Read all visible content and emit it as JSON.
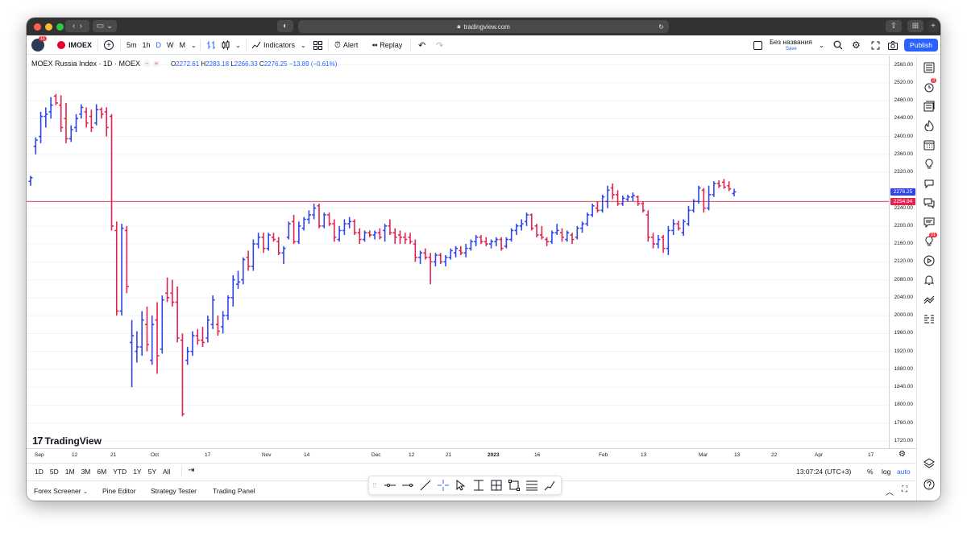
{
  "browser": {
    "url": "tradingview.com"
  },
  "toolbar": {
    "avatar_badge": "11",
    "symbol": "IMOEX",
    "intervals": [
      "5m",
      "1h",
      "D",
      "W",
      "M"
    ],
    "active_interval": "D",
    "indicators_label": "Indicators",
    "alert_label": "Alert",
    "replay_label": "Replay",
    "layout_name": "Без названия",
    "layout_status": "Save",
    "publish_label": "Publish"
  },
  "legend": {
    "title": "MOEX Russia Index · 1D · MOEX",
    "o_label": "O",
    "o_value": "2272.61",
    "h_label": "H",
    "h_value": "2283.18",
    "l_label": "L",
    "l_value": "2266.33",
    "c_label": "C",
    "c_value": "2276.25",
    "change": "−13.89 (−0.61%)"
  },
  "price_axis": {
    "labels": [
      "2560.00",
      "2520.00",
      "2480.00",
      "2440.00",
      "2400.00",
      "2360.00",
      "2320.00",
      "2240.00",
      "2200.00",
      "2160.00",
      "2120.00",
      "2080.00",
      "2040.00",
      "2000.00",
      "1960.00",
      "1920.00",
      "1880.00",
      "1840.00",
      "1800.00",
      "1760.00",
      "1720.00"
    ],
    "last_price": "2276.25",
    "reference_price": "2254.94"
  },
  "time_axis": {
    "labels": [
      "Sep",
      "12",
      "21",
      "Oct",
      "17",
      "Nov",
      "14",
      "Dec",
      "12",
      "21",
      "2023",
      "16",
      "Feb",
      "13",
      "Mar",
      "13",
      "22",
      "Apr",
      "17"
    ]
  },
  "watermark": "TradingView",
  "range_bar": {
    "ranges": [
      "1D",
      "5D",
      "1M",
      "3M",
      "6M",
      "YTD",
      "1Y",
      "5Y",
      "All"
    ],
    "clock": "13:07:24 (UTC+3)",
    "percent_label": "%",
    "log_label": "log",
    "auto_label": "auto"
  },
  "bottom_bar": {
    "tabs": [
      "Forex Screener",
      "Pine Editor",
      "Strategy Tester",
      "Trading Panel"
    ]
  },
  "right_bar": {
    "notification_badge": "3",
    "alerts_badge": "21"
  },
  "colors": {
    "up": "#2f45e8",
    "down": "#e3224f",
    "accent": "#2962ff",
    "reference_line": "#e3224f"
  },
  "chart_data": {
    "type": "ohlc",
    "symbol": "IMOEX",
    "interval": "1D",
    "ylim": [
      1710,
      2570
    ],
    "bars": [
      {
        "o": 2300,
        "h": 2312,
        "l": 2290,
        "c": 2308
      },
      {
        "o": 2378,
        "h": 2398,
        "l": 2360,
        "c": 2392
      },
      {
        "o": 2400,
        "h": 2455,
        "l": 2385,
        "c": 2445
      },
      {
        "o": 2445,
        "h": 2465,
        "l": 2420,
        "c": 2450
      },
      {
        "o": 2455,
        "h": 2488,
        "l": 2440,
        "c": 2470
      },
      {
        "o": 2490,
        "h": 2495,
        "l": 2470,
        "c": 2475
      },
      {
        "o": 2470,
        "h": 2492,
        "l": 2410,
        "c": 2420
      },
      {
        "o": 2440,
        "h": 2475,
        "l": 2385,
        "c": 2395
      },
      {
        "o": 2395,
        "h": 2425,
        "l": 2388,
        "c": 2415
      },
      {
        "o": 2420,
        "h": 2450,
        "l": 2410,
        "c": 2440
      },
      {
        "o": 2450,
        "h": 2472,
        "l": 2440,
        "c": 2465
      },
      {
        "o": 2455,
        "h": 2465,
        "l": 2420,
        "c": 2430
      },
      {
        "o": 2445,
        "h": 2460,
        "l": 2410,
        "c": 2420
      },
      {
        "o": 2430,
        "h": 2472,
        "l": 2425,
        "c": 2460
      },
      {
        "o": 2460,
        "h": 2465,
        "l": 2440,
        "c": 2450
      },
      {
        "o": 2455,
        "h": 2465,
        "l": 2400,
        "c": 2420
      },
      {
        "o": 2445,
        "h": 2450,
        "l": 2190,
        "c": 2200
      },
      {
        "o": 2190,
        "h": 2210,
        "l": 2000,
        "c": 2010
      },
      {
        "o": 2010,
        "h": 2205,
        "l": 2000,
        "c": 2195
      },
      {
        "o": 2190,
        "h": 2200,
        "l": 2050,
        "c": 2065
      },
      {
        "o": 1940,
        "h": 1990,
        "l": 1840,
        "c": 1955
      },
      {
        "o": 1920,
        "h": 1965,
        "l": 1895,
        "c": 1930
      },
      {
        "o": 1930,
        "h": 2010,
        "l": 1910,
        "c": 1990
      },
      {
        "o": 1980,
        "h": 2020,
        "l": 1920,
        "c": 1935
      },
      {
        "o": 1900,
        "h": 2000,
        "l": 1890,
        "c": 1980
      },
      {
        "o": 1990,
        "h": 2030,
        "l": 1870,
        "c": 1910
      },
      {
        "o": 1925,
        "h": 2045,
        "l": 1915,
        "c": 2035
      },
      {
        "o": 2050,
        "h": 2085,
        "l": 2030,
        "c": 2040
      },
      {
        "o": 2050,
        "h": 2080,
        "l": 2020,
        "c": 2030
      },
      {
        "o": 2030,
        "h": 2065,
        "l": 1940,
        "c": 1950
      },
      {
        "o": 1945,
        "h": 1960,
        "l": 1775,
        "c": 1780
      },
      {
        "o": 1900,
        "h": 1930,
        "l": 1890,
        "c": 1920
      },
      {
        "o": 1920,
        "h": 1965,
        "l": 1910,
        "c": 1955
      },
      {
        "o": 1955,
        "h": 1970,
        "l": 1935,
        "c": 1945
      },
      {
        "o": 1945,
        "h": 1975,
        "l": 1930,
        "c": 1940
      },
      {
        "o": 1950,
        "h": 2000,
        "l": 1940,
        "c": 1990
      },
      {
        "o": 1980,
        "h": 2045,
        "l": 1970,
        "c": 2035
      },
      {
        "o": 1980,
        "h": 2000,
        "l": 1955,
        "c": 1965
      },
      {
        "o": 1975,
        "h": 2010,
        "l": 1960,
        "c": 2000
      },
      {
        "o": 2000,
        "h": 2045,
        "l": 1990,
        "c": 2040
      },
      {
        "o": 2040,
        "h": 2090,
        "l": 2020,
        "c": 2080
      },
      {
        "o": 2070,
        "h": 2100,
        "l": 2060,
        "c": 2075
      },
      {
        "o": 2080,
        "h": 2130,
        "l": 2070,
        "c": 2125
      },
      {
        "o": 2130,
        "h": 2145,
        "l": 2100,
        "c": 2110
      },
      {
        "o": 2110,
        "h": 2170,
        "l": 2100,
        "c": 2160
      },
      {
        "o": 2160,
        "h": 2185,
        "l": 2150,
        "c": 2175
      },
      {
        "o": 2175,
        "h": 2185,
        "l": 2140,
        "c": 2150
      },
      {
        "o": 2150,
        "h": 2185,
        "l": 2145,
        "c": 2180
      },
      {
        "o": 2175,
        "h": 2185,
        "l": 2165,
        "c": 2170
      },
      {
        "o": 2165,
        "h": 2175,
        "l": 2135,
        "c": 2140
      },
      {
        "o": 2140,
        "h": 2155,
        "l": 2115,
        "c": 2150
      },
      {
        "o": 2175,
        "h": 2210,
        "l": 2170,
        "c": 2205
      },
      {
        "o": 2210,
        "h": 2225,
        "l": 2160,
        "c": 2165
      },
      {
        "o": 2165,
        "h": 2210,
        "l": 2160,
        "c": 2200
      },
      {
        "o": 2195,
        "h": 2220,
        "l": 2190,
        "c": 2215
      },
      {
        "o": 2215,
        "h": 2235,
        "l": 2205,
        "c": 2225
      },
      {
        "o": 2225,
        "h": 2250,
        "l": 2215,
        "c": 2240
      },
      {
        "o": 2245,
        "h": 2250,
        "l": 2195,
        "c": 2200
      },
      {
        "o": 2200,
        "h": 2230,
        "l": 2195,
        "c": 2225
      },
      {
        "o": 2225,
        "h": 2230,
        "l": 2200,
        "c": 2205
      },
      {
        "o": 2205,
        "h": 2215,
        "l": 2165,
        "c": 2175
      },
      {
        "o": 2170,
        "h": 2200,
        "l": 2165,
        "c": 2190
      },
      {
        "o": 2190,
        "h": 2215,
        "l": 2180,
        "c": 2205
      },
      {
        "o": 2205,
        "h": 2220,
        "l": 2195,
        "c": 2210
      },
      {
        "o": 2210,
        "h": 2215,
        "l": 2180,
        "c": 2185
      },
      {
        "o": 2185,
        "h": 2195,
        "l": 2160,
        "c": 2170
      },
      {
        "o": 2170,
        "h": 2190,
        "l": 2165,
        "c": 2185
      },
      {
        "o": 2185,
        "h": 2190,
        "l": 2175,
        "c": 2180
      },
      {
        "o": 2180,
        "h": 2190,
        "l": 2170,
        "c": 2185
      },
      {
        "o": 2185,
        "h": 2195,
        "l": 2170,
        "c": 2175
      },
      {
        "o": 2190,
        "h": 2205,
        "l": 2165,
        "c": 2200
      },
      {
        "o": 2200,
        "h": 2215,
        "l": 2180,
        "c": 2185
      },
      {
        "o": 2185,
        "h": 2195,
        "l": 2160,
        "c": 2175
      },
      {
        "o": 2180,
        "h": 2190,
        "l": 2160,
        "c": 2175
      },
      {
        "o": 2175,
        "h": 2185,
        "l": 2160,
        "c": 2170
      },
      {
        "o": 2175,
        "h": 2185,
        "l": 2160,
        "c": 2165
      },
      {
        "o": 2160,
        "h": 2170,
        "l": 2120,
        "c": 2130
      },
      {
        "o": 2130,
        "h": 2145,
        "l": 2115,
        "c": 2140
      },
      {
        "o": 2140,
        "h": 2150,
        "l": 2125,
        "c": 2130
      },
      {
        "o": 2130,
        "h": 2140,
        "l": 2070,
        "c": 2120
      },
      {
        "o": 2120,
        "h": 2140,
        "l": 2110,
        "c": 2135
      },
      {
        "o": 2135,
        "h": 2140,
        "l": 2115,
        "c": 2120
      },
      {
        "o": 2120,
        "h": 2135,
        "l": 2110,
        "c": 2130
      },
      {
        "o": 2130,
        "h": 2150,
        "l": 2125,
        "c": 2145
      },
      {
        "o": 2140,
        "h": 2155,
        "l": 2130,
        "c": 2150
      },
      {
        "o": 2145,
        "h": 2155,
        "l": 2135,
        "c": 2140
      },
      {
        "o": 2140,
        "h": 2160,
        "l": 2130,
        "c": 2150
      },
      {
        "o": 2150,
        "h": 2170,
        "l": 2145,
        "c": 2165
      },
      {
        "o": 2165,
        "h": 2180,
        "l": 2155,
        "c": 2175
      },
      {
        "o": 2175,
        "h": 2180,
        "l": 2160,
        "c": 2165
      },
      {
        "o": 2165,
        "h": 2175,
        "l": 2155,
        "c": 2160
      },
      {
        "o": 2160,
        "h": 2170,
        "l": 2150,
        "c": 2165
      },
      {
        "o": 2165,
        "h": 2175,
        "l": 2155,
        "c": 2170
      },
      {
        "o": 2170,
        "h": 2175,
        "l": 2145,
        "c": 2150
      },
      {
        "o": 2155,
        "h": 2175,
        "l": 2150,
        "c": 2170
      },
      {
        "o": 2170,
        "h": 2195,
        "l": 2165,
        "c": 2190
      },
      {
        "o": 2190,
        "h": 2205,
        "l": 2180,
        "c": 2200
      },
      {
        "o": 2200,
        "h": 2215,
        "l": 2190,
        "c": 2205
      },
      {
        "o": 2210,
        "h": 2230,
        "l": 2200,
        "c": 2225
      },
      {
        "o": 2225,
        "h": 2228,
        "l": 2190,
        "c": 2195
      },
      {
        "o": 2200,
        "h": 2205,
        "l": 2175,
        "c": 2180
      },
      {
        "o": 2180,
        "h": 2200,
        "l": 2170,
        "c": 2175
      },
      {
        "o": 2170,
        "h": 2175,
        "l": 2155,
        "c": 2165
      },
      {
        "o": 2165,
        "h": 2190,
        "l": 2160,
        "c": 2185
      },
      {
        "o": 2185,
        "h": 2205,
        "l": 2180,
        "c": 2190
      },
      {
        "o": 2185,
        "h": 2195,
        "l": 2165,
        "c": 2175
      },
      {
        "o": 2170,
        "h": 2190,
        "l": 2165,
        "c": 2185
      },
      {
        "o": 2180,
        "h": 2185,
        "l": 2160,
        "c": 2170
      },
      {
        "o": 2175,
        "h": 2200,
        "l": 2170,
        "c": 2195
      },
      {
        "o": 2195,
        "h": 2210,
        "l": 2185,
        "c": 2205
      },
      {
        "o": 2205,
        "h": 2230,
        "l": 2200,
        "c": 2225
      },
      {
        "o": 2225,
        "h": 2250,
        "l": 2220,
        "c": 2245
      },
      {
        "o": 2240,
        "h": 2255,
        "l": 2230,
        "c": 2235
      },
      {
        "o": 2235,
        "h": 2270,
        "l": 2230,
        "c": 2265
      },
      {
        "o": 2255,
        "h": 2290,
        "l": 2240,
        "c": 2280
      },
      {
        "o": 2285,
        "h": 2295,
        "l": 2260,
        "c": 2270
      },
      {
        "o": 2270,
        "h": 2280,
        "l": 2245,
        "c": 2250
      },
      {
        "o": 2250,
        "h": 2268,
        "l": 2245,
        "c": 2262
      },
      {
        "o": 2260,
        "h": 2270,
        "l": 2255,
        "c": 2265
      },
      {
        "o": 2265,
        "h": 2275,
        "l": 2255,
        "c": 2268
      },
      {
        "o": 2265,
        "h": 2268,
        "l": 2245,
        "c": 2250
      },
      {
        "o": 2250,
        "h": 2255,
        "l": 2230,
        "c": 2235
      },
      {
        "o": 2225,
        "h": 2235,
        "l": 2165,
        "c": 2175
      },
      {
        "o": 2175,
        "h": 2185,
        "l": 2150,
        "c": 2160
      },
      {
        "o": 2160,
        "h": 2180,
        "l": 2150,
        "c": 2170
      },
      {
        "o": 2175,
        "h": 2180,
        "l": 2140,
        "c": 2150
      },
      {
        "o": 2150,
        "h": 2200,
        "l": 2135,
        "c": 2190
      },
      {
        "o": 2190,
        "h": 2215,
        "l": 2180,
        "c": 2205
      },
      {
        "o": 2205,
        "h": 2212,
        "l": 2190,
        "c": 2195
      },
      {
        "o": 2185,
        "h": 2215,
        "l": 2178,
        "c": 2210
      },
      {
        "o": 2205,
        "h": 2245,
        "l": 2200,
        "c": 2235
      },
      {
        "o": 2235,
        "h": 2260,
        "l": 2230,
        "c": 2255
      },
      {
        "o": 2255,
        "h": 2290,
        "l": 2250,
        "c": 2285
      },
      {
        "o": 2280,
        "h": 2285,
        "l": 2230,
        "c": 2240
      },
      {
        "o": 2240,
        "h": 2290,
        "l": 2235,
        "c": 2270
      },
      {
        "o": 2270,
        "h": 2300,
        "l": 2265,
        "c": 2295
      },
      {
        "o": 2295,
        "h": 2302,
        "l": 2285,
        "c": 2290
      },
      {
        "o": 2298,
        "h": 2305,
        "l": 2283,
        "c": 2287
      },
      {
        "o": 2290,
        "h": 2300,
        "l": 2278,
        "c": 2283
      },
      {
        "o": 2272.61,
        "h": 2283.18,
        "l": 2266.33,
        "c": 2276.25
      }
    ]
  }
}
